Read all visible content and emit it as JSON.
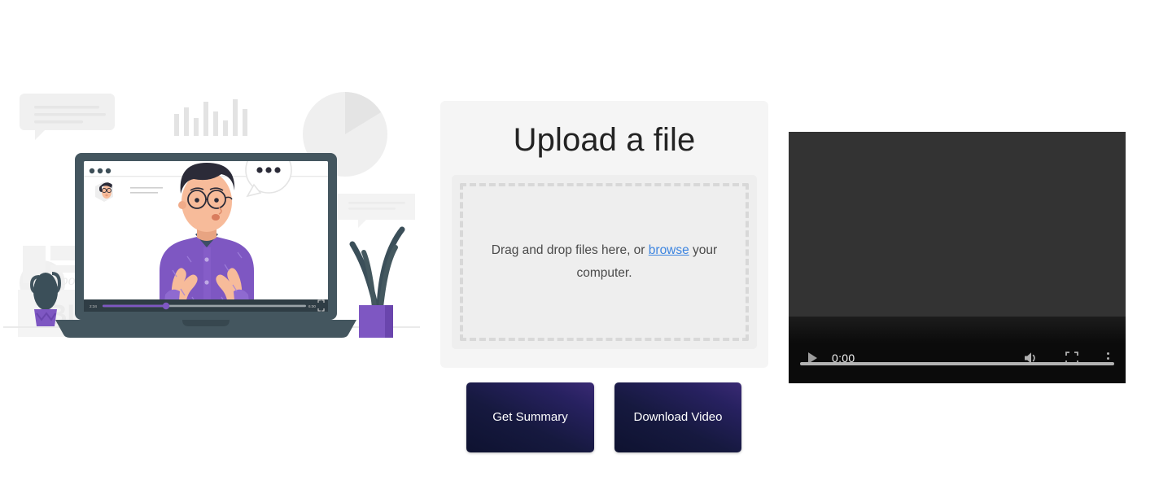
{
  "upload": {
    "title": "Upload a file",
    "dropzone_text_before": "Drag and drop files here, or ",
    "dropzone_link": "browse",
    "dropzone_text_after": " your computer."
  },
  "actions": {
    "get_summary_label": "Get Summary",
    "download_video_label": "Download Video"
  },
  "video": {
    "current_time": "0:00",
    "play_icon": "play-icon",
    "volume_icon": "volume-icon",
    "fullscreen_icon": "fullscreen-icon",
    "more_options_icon": "kebab-menu-icon"
  },
  "illustration": {
    "alt_name": "video-call-illustration",
    "laptop_time_current": "2:34",
    "laptop_time_total": "6:00",
    "background_word_1": "Typogra",
    "background_word_2": "BLO"
  },
  "colors": {
    "page_background": "#ffffff",
    "card_background": "#f5f5f5",
    "dropzone_background": "#eeeeee",
    "dropzone_border": "#d8d8d8",
    "link_blue": "#3d85e0",
    "button_gradient_start": "#3a2a74",
    "button_gradient_end": "#0e1230",
    "video_background": "#333333",
    "video_controls_background": "#0b0b0b",
    "illustration_purple": "#7e57c2",
    "illustration_dark": "#3f4d5a",
    "illustration_skin": "#f7bb9a"
  }
}
